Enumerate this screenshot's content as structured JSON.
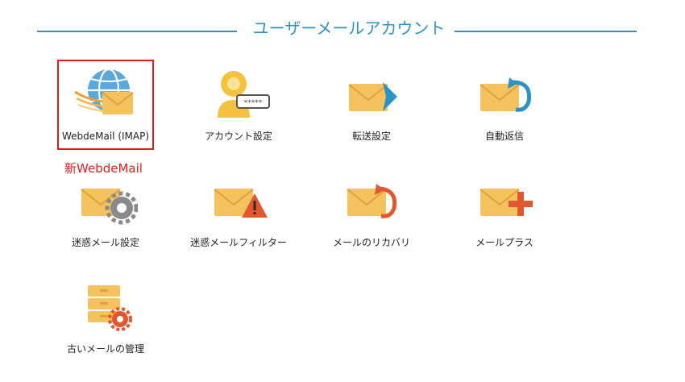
{
  "section": {
    "title": "ユーザーメールアカウント"
  },
  "note": {
    "text": "新WebdeMail"
  },
  "tiles": [
    {
      "label": "WebdeMail (IMAP)"
    },
    {
      "label": "アカウント設定"
    },
    {
      "label": "転送設定"
    },
    {
      "label": "自動返信"
    },
    {
      "label": "迷惑メール設定"
    },
    {
      "label": "迷惑メールフィルター"
    },
    {
      "label": "メールのリカバリ"
    },
    {
      "label": "メールプラス"
    },
    {
      "label": "古いメールの管理"
    }
  ],
  "icons": {
    "password_mask": "*****",
    "tile0": "globe-envelope-icon",
    "tile1": "user-password-icon",
    "tile2": "envelope-forward-arrow-icon",
    "tile3": "envelope-reply-arrow-icon",
    "tile4": "envelope-gear-icon",
    "tile5": "envelope-warning-icon",
    "tile6": "envelope-recovery-icon",
    "tile7": "envelope-plus-icon",
    "tile8": "archive-gear-icon"
  },
  "colors": {
    "accent": "#2b93c6",
    "selection_border": "#e11d1d",
    "note": "#e01e1e",
    "envelope": "#f4c25e",
    "warning": "#e4572e"
  }
}
